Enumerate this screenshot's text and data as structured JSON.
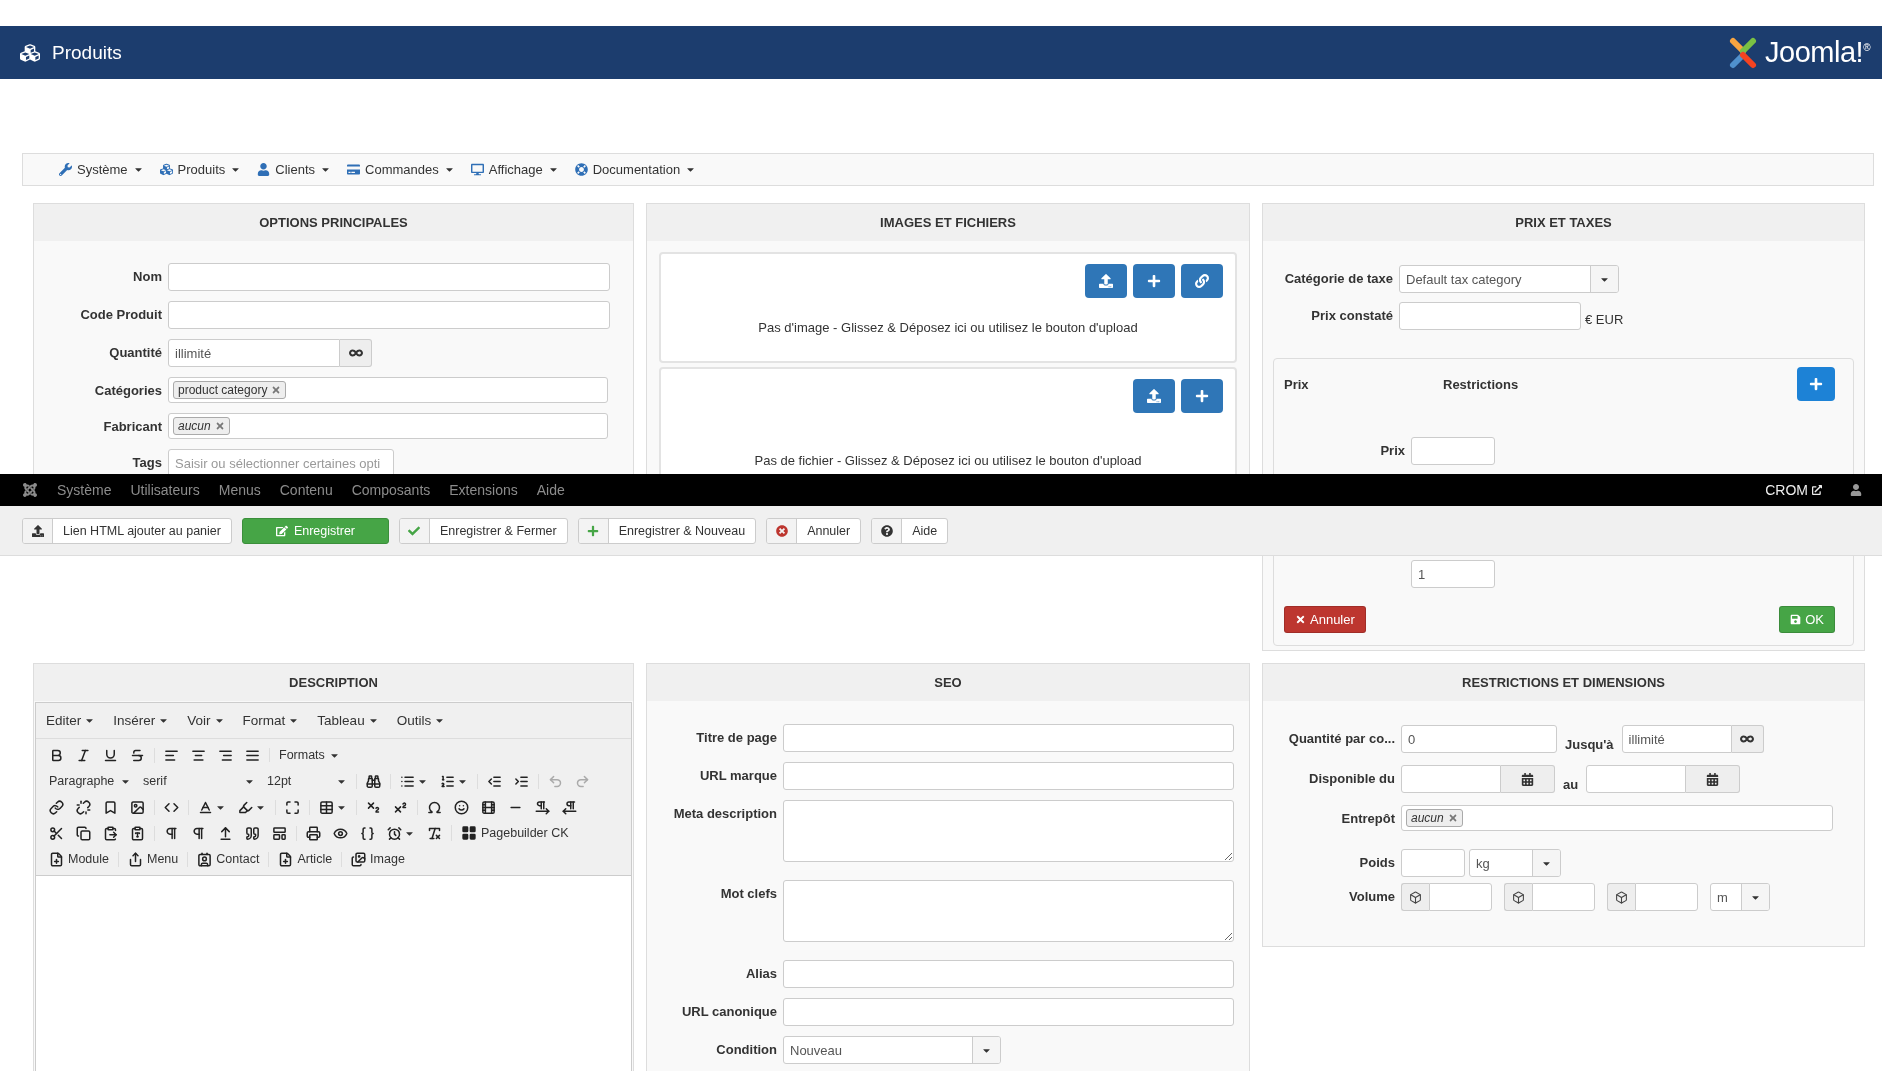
{
  "header": {
    "title": "Produits",
    "logo": "Joomla!$^{®}$"
  },
  "menu": [
    {
      "label": "Système"
    },
    {
      "label": "Produits"
    },
    {
      "label": "Clients"
    },
    {
      "label": "Commandes"
    },
    {
      "label": "Affichage"
    },
    {
      "label": "Documentation"
    }
  ],
  "main_options": {
    "title": "OPTIONS PRINCIPALES",
    "fields": [
      {
        "kind": "text",
        "label": "Nom"
      },
      {
        "kind": "text",
        "label": "Code Produit"
      },
      {
        "kind": "infinite",
        "label": "Quantité",
        "value": "illimité"
      },
      {
        "kind": "tags",
        "label": "Catégories",
        "tags": [
          {
            "label": "product category",
            "italic": false
          }
        ]
      },
      {
        "kind": "tags",
        "label": "Fabricant",
        "tags": [
          {
            "label": "aucun",
            "italic": true
          }
        ]
      },
      {
        "kind": "short",
        "label": "Tags",
        "placeholder": "Saisir ou sélectionner certaines opti"
      }
    ]
  },
  "images": {
    "title": "IMAGES ET FICHIERS",
    "zones": [
      {
        "buttons": [
          {
            "kind": "upload"
          },
          {
            "kind": "add"
          },
          {
            "kind": "link"
          }
        ],
        "text": "Pas d'image - Glissez & Déposez ici ou utilisez le bouton d'upload"
      },
      {
        "buttons": [
          {
            "kind": "upload"
          },
          {
            "kind": "add"
          }
        ],
        "text": "Pas de fichier - Glissez & Déposez ici ou utilisez le bouton d'upload"
      }
    ]
  },
  "prices": {
    "title": "PRIX ET TAXES",
    "tax_label": "Catégorie de taxe",
    "tax_value": "Default tax category",
    "price_label": "Prix constaté",
    "currency": "€ EUR",
    "editor": {
      "col_price": "Prix",
      "col_restrictions": "Restrictions",
      "price_label": "Prix",
      "quantity_value": "1",
      "cancel": "Annuler",
      "ok": "OK"
    }
  },
  "admin_bar": {
    "items": [
      "Système",
      "Utilisateurs",
      "Menus",
      "Contenu",
      "Composants",
      "Extensions",
      "Aide"
    ],
    "user": "CROM"
  },
  "toolbar": [
    {
      "label": "Lien HTML ajouter au panier",
      "kind": "default"
    },
    {
      "label": "Enregistrer",
      "kind": "primary"
    },
    {
      "label": "Enregistrer & Fermer",
      "kind": "default"
    },
    {
      "label": "Enregistrer & Nouveau",
      "kind": "default"
    },
    {
      "label": "Annuler",
      "kind": "default"
    },
    {
      "label": "Aide",
      "kind": "default"
    }
  ],
  "description": {
    "title": "DESCRIPTION",
    "menus": [
      "Editer",
      "Insérer",
      "Voir",
      "Format",
      "Tableau",
      "Outils"
    ],
    "formats": "Formats",
    "block": "Paragraphe",
    "font": "serif",
    "size": "12pt",
    "undo_disabled": true,
    "pagebuilder": "Pagebuilder CK",
    "inserts": [
      "Module",
      "Menu",
      "Contact",
      "Article",
      "Image"
    ]
  },
  "seo": {
    "title": "SEO",
    "fields": [
      {
        "kind": "text",
        "label": "Titre de page"
      },
      {
        "kind": "text",
        "label": "URL marque"
      },
      {
        "kind": "textarea",
        "label": "Meta description"
      },
      {
        "kind": "textarea",
        "label": "Mot clefs"
      },
      {
        "kind": "text",
        "label": "Alias"
      },
      {
        "kind": "text",
        "label": "URL canonique"
      },
      {
        "kind": "select",
        "label": "Condition",
        "value": "Nouveau"
      }
    ]
  },
  "restrictions": {
    "title": "RESTRICTIONS ET DIMENSIONS",
    "qty_label": "Quantité par co...",
    "qty_value": "0",
    "until_label": "Jusqu'à",
    "until_value": "illimité",
    "from_label": "Disponible du",
    "to_label": "au",
    "warehouse_label": "Entrepôt",
    "warehouse_tags": [
      {
        "label": "aucun",
        "italic": true
      }
    ],
    "weight_label": "Poids",
    "weight_unit": "kg",
    "volume_label": "Volume",
    "volume_unit": "m"
  }
}
